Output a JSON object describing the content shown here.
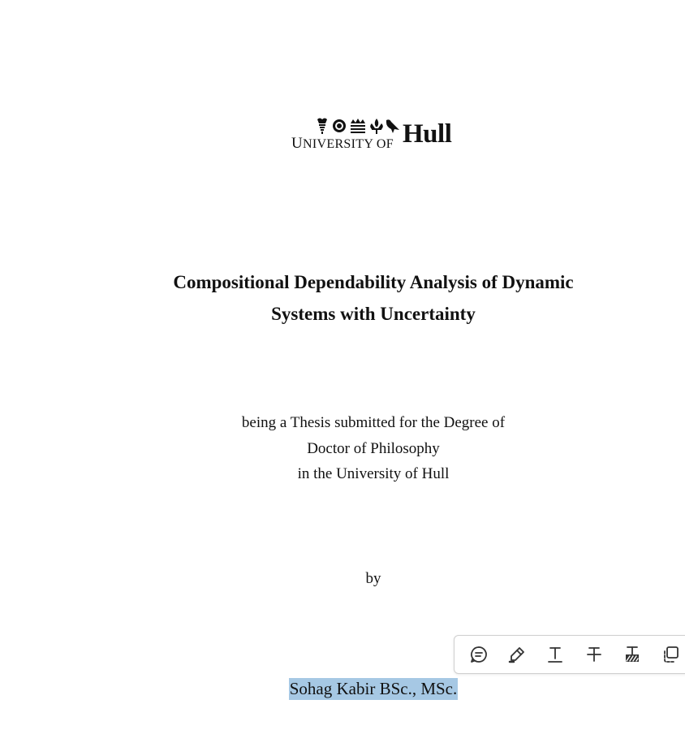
{
  "logo": {
    "prefix_first_letter": "U",
    "prefix_rest": "NIVERSITY OF",
    "name": "Hull",
    "icons": [
      "lily-icon",
      "rose-icon",
      "crown-icon",
      "fleur-de-lis-icon",
      "bird-icon"
    ]
  },
  "title": {
    "line1": "Compositional Dependability Analysis of Dynamic",
    "line2": "Systems with Uncertainty"
  },
  "submission": {
    "line1": "being a Thesis submitted for the Degree of",
    "line2": "Doctor of Philosophy",
    "line3": "in the University of Hull"
  },
  "by": "by",
  "author": {
    "name": "Sohag Kabir BSc., MSc.",
    "selection_color": "#a6c8e4"
  },
  "toolbar": {
    "buttons": [
      {
        "icon": "comment-icon"
      },
      {
        "icon": "highlight-pen-icon"
      },
      {
        "icon": "underline-text-icon"
      },
      {
        "icon": "strikethrough-icon"
      },
      {
        "icon": "squiggly-icon"
      },
      {
        "icon": "copy-icon"
      }
    ]
  }
}
